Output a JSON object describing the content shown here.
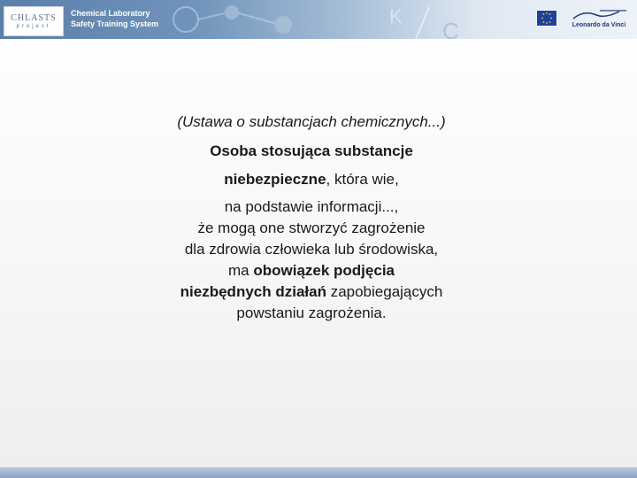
{
  "header": {
    "logo_main": "CHLASTS",
    "logo_sub": "project",
    "app_title_line1": "Chemical Laboratory",
    "app_title_line2": "Safety Training System",
    "partner_logo": "Leonardo da Vinci"
  },
  "slide": {
    "reference": "(Ustawa o substancjach chemicznych...)",
    "line1": "Osoba stosująca substancje",
    "line2_bold": "niebezpieczne",
    "line2_rest": ", która wie,",
    "line3": "na podstawie informacji...,",
    "line4": "że mogą one stworzyć zagrożenie",
    "line5": "dla zdrowia człowieka  lub środowiska,",
    "line6_pre": "ma ",
    "line6_bold": "obowiązek podjęcia",
    "line7_bold": "niezbędnych działań",
    "line7_rest": " zapobiegających",
    "line8": "powstaniu zagrożenia."
  },
  "colors": {
    "header_blue": "#5b7fa8",
    "eu_blue": "#1e3fa0",
    "eu_stars": "#ffd700",
    "text": "#1a1a1a"
  },
  "icons": [
    "chlasts-logo",
    "eu-flag-icon",
    "leonardo-da-vinci-logo"
  ]
}
